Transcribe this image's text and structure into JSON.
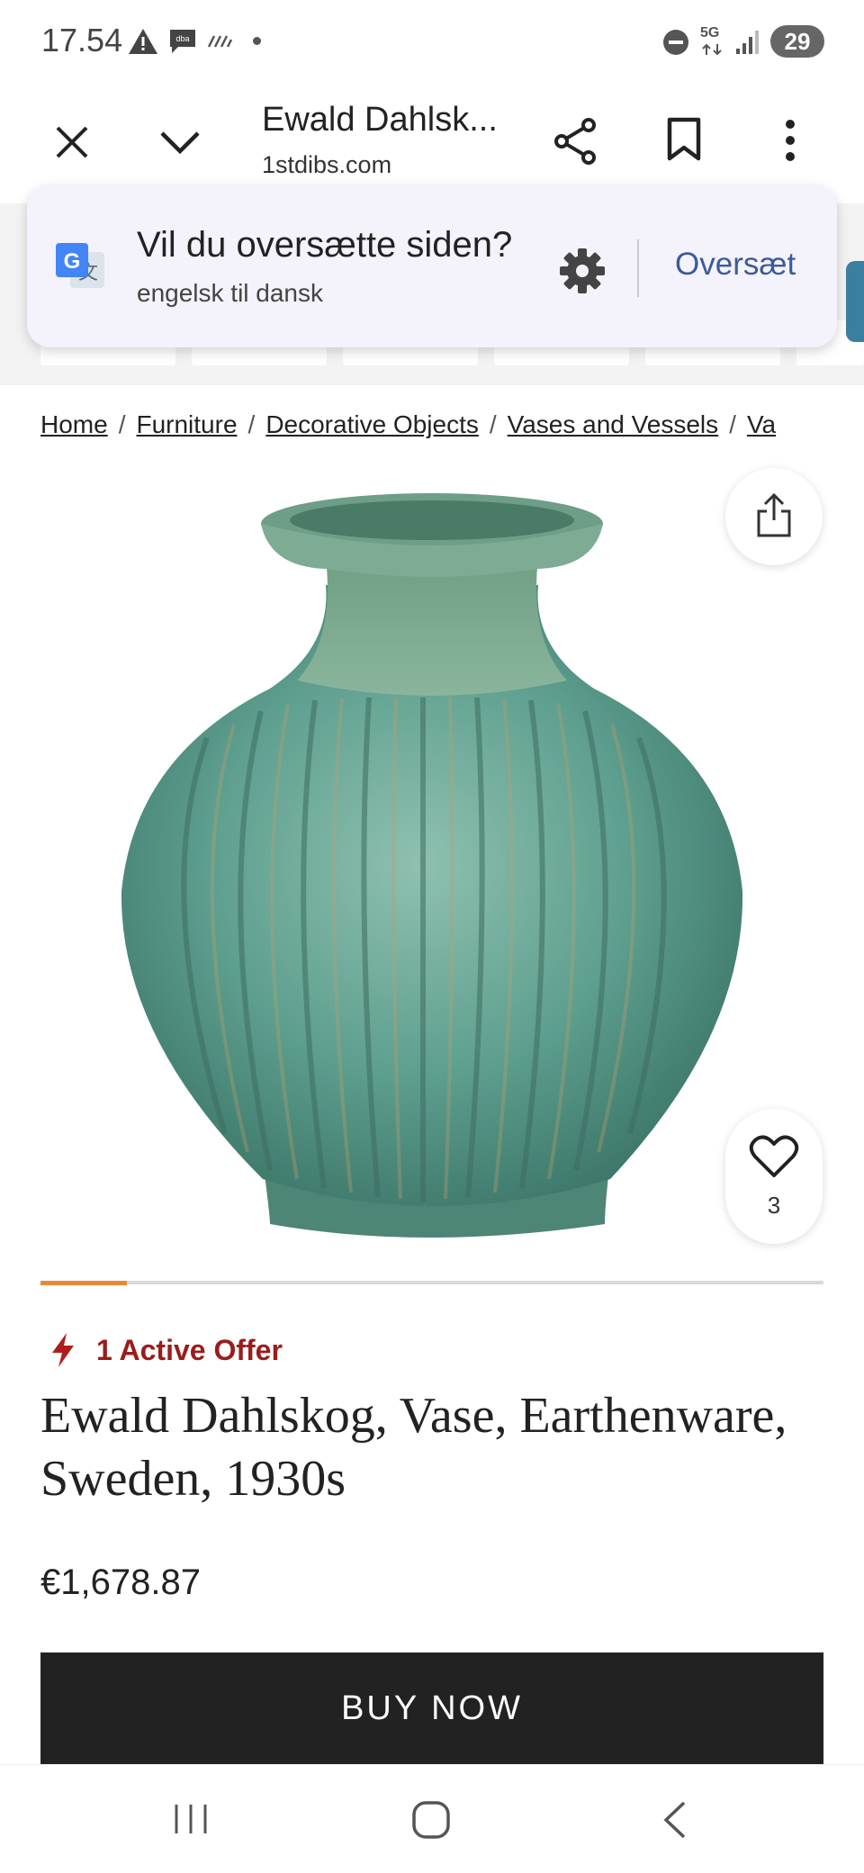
{
  "status_bar": {
    "time": "17.54",
    "network": "5G",
    "battery": "29"
  },
  "browser": {
    "title": "Ewald Dahlsk...",
    "domain": "1stdibs.com"
  },
  "translate": {
    "question": "Vil du oversætte siden?",
    "languages": "engelsk til dansk",
    "button": "Oversæt"
  },
  "breadcrumb": {
    "items": [
      "Home",
      "Furniture",
      "Decorative Objects",
      "Vases and Vessels",
      "Va"
    ]
  },
  "product": {
    "favorites_count": "3",
    "carousel_progress_fraction": 0.11,
    "offer_text": "1 Active Offer",
    "title": "Ewald Dahlskog, Vase, Earthenware, Sweden, 1930s",
    "price": "€1,678.87",
    "buy_button": "BUY NOW"
  },
  "colors": {
    "offer_red": "#9b1c1c",
    "accent_orange": "#e8893a",
    "translate_blue": "#3b5b9a",
    "vase_green": "#5fa090"
  }
}
